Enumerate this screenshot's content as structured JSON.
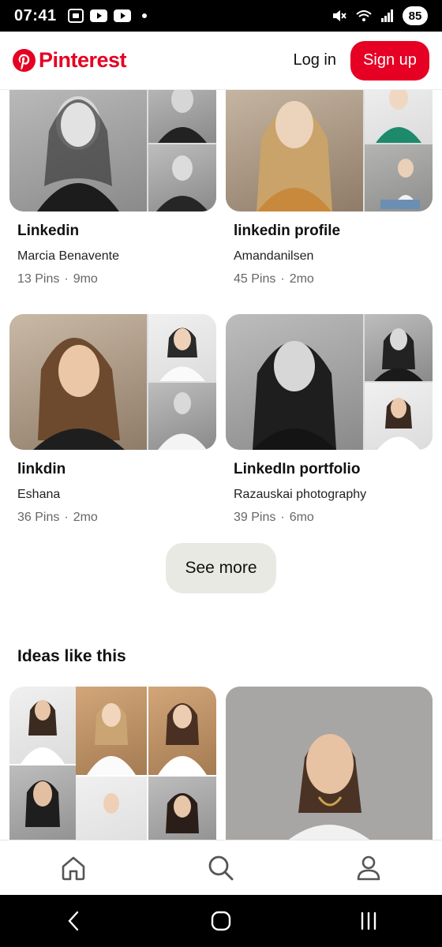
{
  "status_bar": {
    "time": "07:41",
    "battery": "85"
  },
  "header": {
    "brand": "Pinterest",
    "login_label": "Log in",
    "signup_label": "Sign up"
  },
  "boards": [
    {
      "title": "Linkedin",
      "owner": "Marcia Benavente",
      "pins": "13 Pins",
      "age": "9mo"
    },
    {
      "title": "linkedin profile",
      "owner": "Amandanilsen",
      "pins": "45 Pins",
      "age": "2mo"
    },
    {
      "title": "linkdin",
      "owner": "Eshana",
      "pins": "36 Pins",
      "age": "2mo"
    },
    {
      "title": "LinkedIn portfolio",
      "owner": "Razauskai photography",
      "pins": "39 Pins",
      "age": "6mo"
    }
  ],
  "see_more_label": "See more",
  "ideas_title": "Ideas like this",
  "meta_separator": "·",
  "colors": {
    "brand_red": "#e60023",
    "see_more_bg": "#e9e9e4",
    "text_muted": "#666666"
  },
  "icons": {
    "status": [
      "screenshot-icon",
      "youtube-icon",
      "youtube-icon",
      "mute-icon",
      "wifi-icon",
      "signal-icon"
    ],
    "bottom_nav": [
      "home-icon",
      "search-icon",
      "profile-icon"
    ],
    "system_nav": [
      "back-icon",
      "home-circle-icon",
      "recents-icon"
    ]
  }
}
